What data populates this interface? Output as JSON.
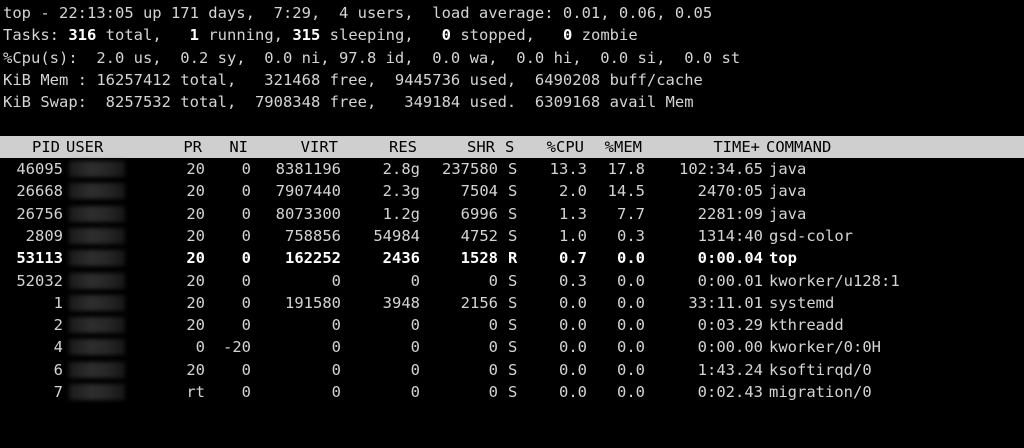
{
  "summary": {
    "line1": "top - 22:13:05 up 171 days,  7:29,  4 users,  load average: 0.01, 0.06, 0.05",
    "tasks_label": "Tasks: ",
    "tasks_total": "316",
    "tasks_total_suffix": " total,   ",
    "tasks_running": "1",
    "tasks_running_suffix": " running, ",
    "tasks_sleeping": "315",
    "tasks_sleeping_suffix": " sleeping,   ",
    "tasks_stopped": "0",
    "tasks_stopped_suffix": " stopped,   ",
    "tasks_zombie": "0",
    "tasks_zombie_suffix": " zombie",
    "cpu_line": "%Cpu(s):  2.0 us,  0.2 sy,  0.0 ni, 97.8 id,  0.0 wa,  0.0 hi,  0.0 si,  0.0 st",
    "mem_line": "KiB Mem : 16257412 total,   321468 free,  9445736 used,  6490208 buff/cache",
    "swap_line": "KiB Swap:  8257532 total,  7908348 free,   349184 used.  6309168 avail Mem"
  },
  "columns": {
    "pid": "PID",
    "user": "USER",
    "pr": "PR",
    "ni": "NI",
    "virt": "VIRT",
    "res": "RES",
    "shr": "SHR",
    "s": "S",
    "cpu": "%CPU",
    "mem": "%MEM",
    "time": "TIME+",
    "command": "COMMAND"
  },
  "processes": [
    {
      "pid": "46095",
      "pr": "20",
      "ni": "0",
      "virt": "8381196",
      "res": "2.8g",
      "shr": "237580",
      "s": "S",
      "cpu": "13.3",
      "mem": "17.8",
      "time": "102:34.65",
      "command": "java"
    },
    {
      "pid": "26668",
      "pr": "20",
      "ni": "0",
      "virt": "7907440",
      "res": "2.3g",
      "shr": "7504",
      "s": "S",
      "cpu": "2.0",
      "mem": "14.5",
      "time": "2470:05",
      "command": "java"
    },
    {
      "pid": "26756",
      "pr": "20",
      "ni": "0",
      "virt": "8073300",
      "res": "1.2g",
      "shr": "6996",
      "s": "S",
      "cpu": "1.3",
      "mem": "7.7",
      "time": "2281:09",
      "command": "java"
    },
    {
      "pid": "2809",
      "pr": "20",
      "ni": "0",
      "virt": "758856",
      "res": "54984",
      "shr": "4752",
      "s": "S",
      "cpu": "1.0",
      "mem": "0.3",
      "time": "1314:40",
      "command": "gsd-color"
    },
    {
      "pid": "53113",
      "pr": "20",
      "ni": "0",
      "virt": "162252",
      "res": "2436",
      "shr": "1528",
      "s": "R",
      "cpu": "0.7",
      "mem": "0.0",
      "time": "0:00.04",
      "command": "top"
    },
    {
      "pid": "52032",
      "pr": "20",
      "ni": "0",
      "virt": "0",
      "res": "0",
      "shr": "0",
      "s": "S",
      "cpu": "0.3",
      "mem": "0.0",
      "time": "0:00.01",
      "command": "kworker/u128:1"
    },
    {
      "pid": "1",
      "pr": "20",
      "ni": "0",
      "virt": "191580",
      "res": "3948",
      "shr": "2156",
      "s": "S",
      "cpu": "0.0",
      "mem": "0.0",
      "time": "33:11.01",
      "command": "systemd"
    },
    {
      "pid": "2",
      "pr": "20",
      "ni": "0",
      "virt": "0",
      "res": "0",
      "shr": "0",
      "s": "S",
      "cpu": "0.0",
      "mem": "0.0",
      "time": "0:03.29",
      "command": "kthreadd"
    },
    {
      "pid": "4",
      "pr": "0",
      "ni": "-20",
      "virt": "0",
      "res": "0",
      "shr": "0",
      "s": "S",
      "cpu": "0.0",
      "mem": "0.0",
      "time": "0:00.00",
      "command": "kworker/0:0H"
    },
    {
      "pid": "6",
      "pr": "20",
      "ni": "0",
      "virt": "0",
      "res": "0",
      "shr": "0",
      "s": "S",
      "cpu": "0.0",
      "mem": "0.0",
      "time": "1:43.24",
      "command": "ksoftirqd/0"
    },
    {
      "pid": "7",
      "pr": "rt",
      "ni": "0",
      "virt": "0",
      "res": "0",
      "shr": "0",
      "s": "S",
      "cpu": "0.0",
      "mem": "0.0",
      "time": "0:02.43",
      "command": "migration/0"
    }
  ],
  "highlighted_pid": "53113",
  "colors": {
    "background": "#000000",
    "text": "#d4d4d4",
    "header_bar": "#cfcfcf"
  }
}
